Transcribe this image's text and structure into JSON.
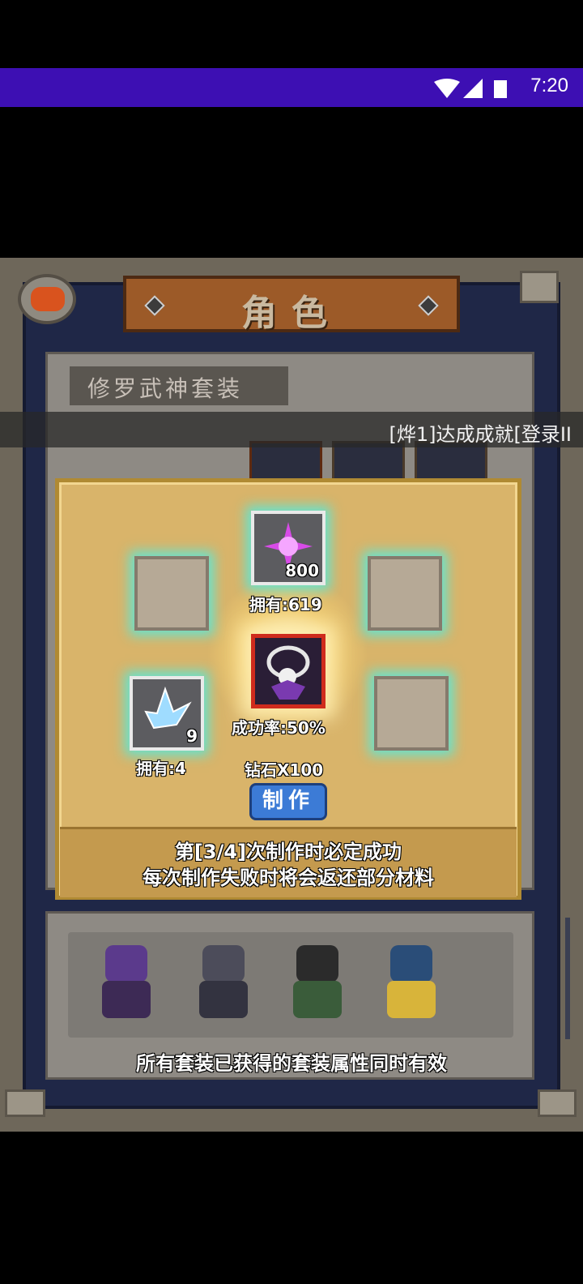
{
  "status_bar": {
    "time": "7:20",
    "icons": [
      "wifi-icon",
      "signal-icon",
      "battery-icon"
    ]
  },
  "header": {
    "title": "角色",
    "back_icon": "back-arrow-icon"
  },
  "set": {
    "name": "修罗武神套装"
  },
  "notice": {
    "text": "[烨1]达成成就[登录II"
  },
  "craft": {
    "top_slot": {
      "count": "800",
      "owned_label": "拥有:619",
      "icon": "purple-crystal-icon"
    },
    "left_slot": {
      "count": "9",
      "owned_label": "拥有:4",
      "icon": "ice-crystal-icon"
    },
    "center": {
      "rate_label": "成功率:50%",
      "icon": "skull-necklace-icon"
    },
    "cost_label": "钻石X100",
    "button_label": "制作",
    "info_line1": "第[3/4]次制作时必定成功",
    "info_line2": "每次制作失败时将会返还部分材料"
  },
  "characters": [
    "purple-samurai",
    "hooded-ninja",
    "cowboy-hat",
    "horned-knight"
  ],
  "footer_note": "所有套装已获得的套装属性同时有效",
  "colors": {
    "status_bar": "#3d0fb3",
    "craft_button": "#3c7bd6",
    "slot_glow": "#50ebe1",
    "title_banner": "#9c5a28"
  }
}
